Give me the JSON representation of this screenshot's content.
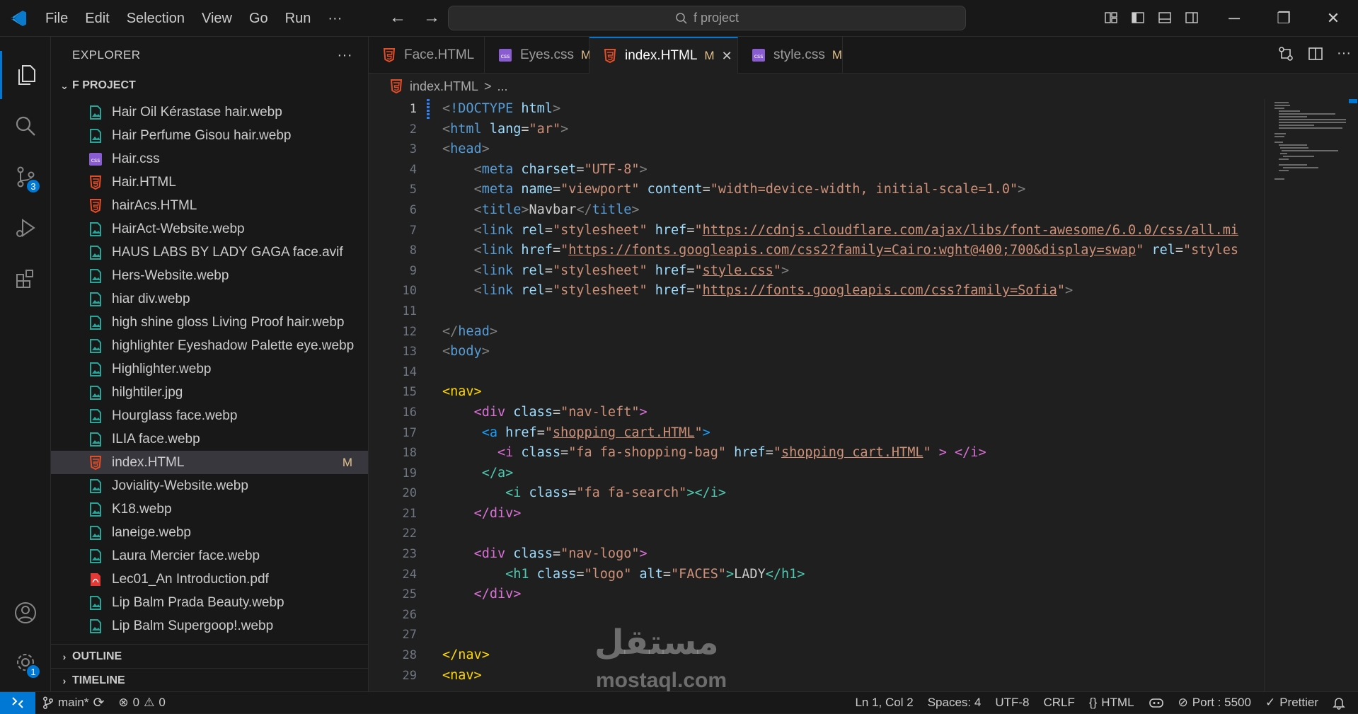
{
  "titlebar": {
    "menu": [
      "File",
      "Edit",
      "Selection",
      "View",
      "Go",
      "Run",
      "···"
    ],
    "search_text": "f project"
  },
  "activity_bar": {
    "items": [
      "explorer-icon",
      "search-icon",
      "source-control-icon",
      "run-debug-icon",
      "extensions-icon"
    ],
    "source_control_badge": "3",
    "settings_badge": "1"
  },
  "explorer": {
    "title": "EXPLORER",
    "more": "···",
    "folder": "F PROJECT",
    "files": [
      {
        "name": "Hair Oil Kérastase hair.webp",
        "type": "image"
      },
      {
        "name": "Hair Perfume Gisou hair.webp",
        "type": "image"
      },
      {
        "name": "Hair.css",
        "type": "css"
      },
      {
        "name": "Hair.HTML",
        "type": "html"
      },
      {
        "name": "hairAcs.HTML",
        "type": "html"
      },
      {
        "name": "HairAct-Website.webp",
        "type": "image"
      },
      {
        "name": "HAUS LABS BY LADY GAGA face.avif",
        "type": "image"
      },
      {
        "name": "Hers-Website.webp",
        "type": "image"
      },
      {
        "name": "hiar div.webp",
        "type": "image"
      },
      {
        "name": "high shine gloss Living Proof hair.webp",
        "type": "image"
      },
      {
        "name": "highlighter Eyeshadow Palette eye.webp",
        "type": "image"
      },
      {
        "name": "Highlighter.webp",
        "type": "image"
      },
      {
        "name": "hilghtiler.jpg",
        "type": "image"
      },
      {
        "name": "Hourglass face.webp",
        "type": "image"
      },
      {
        "name": "ILIA face.webp",
        "type": "image"
      },
      {
        "name": "index.HTML",
        "type": "html",
        "status": "M",
        "selected": true
      },
      {
        "name": "Joviality-Website.webp",
        "type": "image"
      },
      {
        "name": "K18.webp",
        "type": "image"
      },
      {
        "name": "laneige.webp",
        "type": "image"
      },
      {
        "name": "Laura Mercier face.webp",
        "type": "image"
      },
      {
        "name": "Lec01_An Introduction.pdf",
        "type": "pdf"
      },
      {
        "name": "Lip Balm Prada Beauty.webp",
        "type": "image"
      },
      {
        "name": "Lip Balm Supergoop!.webp",
        "type": "image"
      }
    ],
    "outline": "OUTLINE",
    "timeline": "TIMELINE"
  },
  "tabs": [
    {
      "label": "Face.HTML",
      "type": "html",
      "status": ""
    },
    {
      "label": "Eyes.css",
      "type": "css",
      "status": "M"
    },
    {
      "label": "index.HTML",
      "type": "html",
      "status": "M",
      "active": true
    },
    {
      "label": "style.css",
      "type": "css",
      "status": "M"
    }
  ],
  "breadcrumb": {
    "file": "index.HTML",
    "sep": ">",
    "rest": "..."
  },
  "editor": {
    "line_numbers": [
      "1",
      "2",
      "3",
      "4",
      "5",
      "6",
      "7",
      "8",
      "9",
      "10",
      "11",
      "12",
      "13",
      "14",
      "15",
      "16",
      "17",
      "18",
      "19",
      "20",
      "21",
      "22",
      "23",
      "24",
      "25",
      "26",
      "27",
      "28",
      "29"
    ],
    "current_line": 1
  },
  "statusbar": {
    "branch": "main*",
    "errors": "0",
    "warnings": "0",
    "position": "Ln 1, Col 2",
    "spaces": "Spaces: 4",
    "encoding": "UTF-8",
    "eol": "CRLF",
    "language": "HTML",
    "port": "Port : 5500",
    "prettier": "Prettier"
  },
  "watermark": {
    "arabic": "مستقل",
    "latin": "mostaql.com"
  },
  "colors": {
    "accent": "#0078d4",
    "modified": "#e2c08d",
    "html_icon": "#e44d26",
    "css_icon": "#8a5cd1",
    "image_icon": "#26a69a",
    "pdf_icon": "#e53935"
  }
}
